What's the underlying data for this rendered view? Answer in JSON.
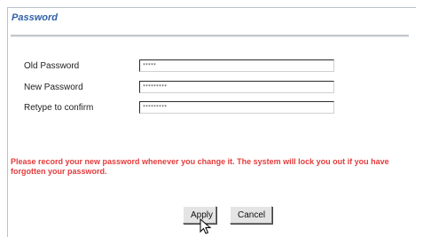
{
  "section": {
    "title": "Password"
  },
  "form": {
    "old_password": {
      "label": "Old Password",
      "value": "*****"
    },
    "new_password": {
      "label": "New Password",
      "value": "*********"
    },
    "retype_password": {
      "label": "Retype to confirm",
      "value": "*********"
    }
  },
  "warning": "Please record your new password whenever you change it. The system will lock you out if you have forgotten your password.",
  "buttons": {
    "apply": "Apply",
    "cancel": "Cancel"
  },
  "colors": {
    "title": "#2f5fa8",
    "warning": "#e43b3b",
    "button_face": "#e4e4e4"
  },
  "cursor_icon": "pointer-cursor-icon"
}
